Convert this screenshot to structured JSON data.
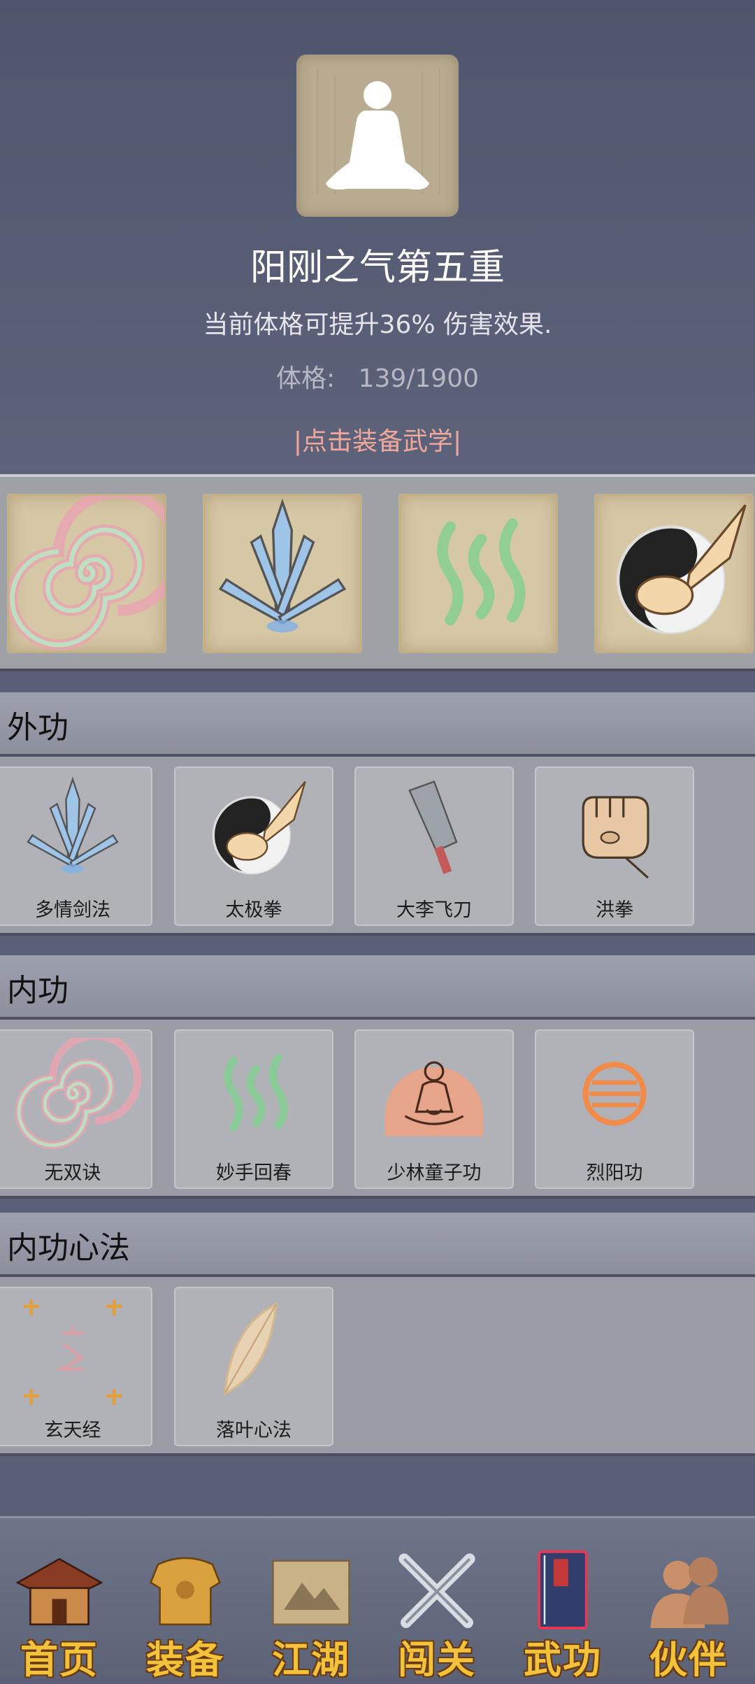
{
  "header": {
    "avatar_icon": "meditation-figure-icon",
    "title": "阳刚之气第五重",
    "description": "当前体格可提升36% 伤害效果.",
    "stat_label": "体格:",
    "stat_value": "139/1900",
    "equip_link": "|点击装备武学|"
  },
  "equipped_slots": [
    {
      "icon": "spiral-icon"
    },
    {
      "icon": "sword-fan-icon"
    },
    {
      "icon": "green-wave-icon"
    },
    {
      "icon": "taiji-fist-icon"
    }
  ],
  "sections": [
    {
      "title": "外功",
      "items": [
        {
          "label": "多情剑法",
          "icon": "sword-fan-icon"
        },
        {
          "label": "太极拳",
          "icon": "taiji-fist-icon"
        },
        {
          "label": "大李飞刀",
          "icon": "cleaver-icon"
        },
        {
          "label": "洪拳",
          "icon": "fist-icon"
        }
      ]
    },
    {
      "title": "内功",
      "items": [
        {
          "label": "无双诀",
          "icon": "spiral-icon"
        },
        {
          "label": "妙手回春",
          "icon": "green-wave-icon"
        },
        {
          "label": "少林童子功",
          "icon": "meditation-monk-icon"
        },
        {
          "label": "烈阳功",
          "icon": "fire-orb-icon"
        }
      ]
    },
    {
      "title": "内功心法",
      "items": [
        {
          "label": "玄天经",
          "icon": "xuan-scroll-icon"
        },
        {
          "label": "落叶心法",
          "icon": "leaf-icon"
        }
      ]
    }
  ],
  "nav": [
    {
      "label": "首页",
      "icon": "pavilion-icon"
    },
    {
      "label": "装备",
      "icon": "armor-icon"
    },
    {
      "label": "江湖",
      "icon": "scroll-map-icon"
    },
    {
      "label": "闯关",
      "icon": "crossed-swords-icon"
    },
    {
      "label": "武功",
      "icon": "martial-book-icon"
    },
    {
      "label": "伙伴",
      "icon": "companions-icon"
    }
  ],
  "colors": {
    "background": "#5a6077",
    "link": "#f1a89a",
    "nav_label": "#f2c33a"
  }
}
